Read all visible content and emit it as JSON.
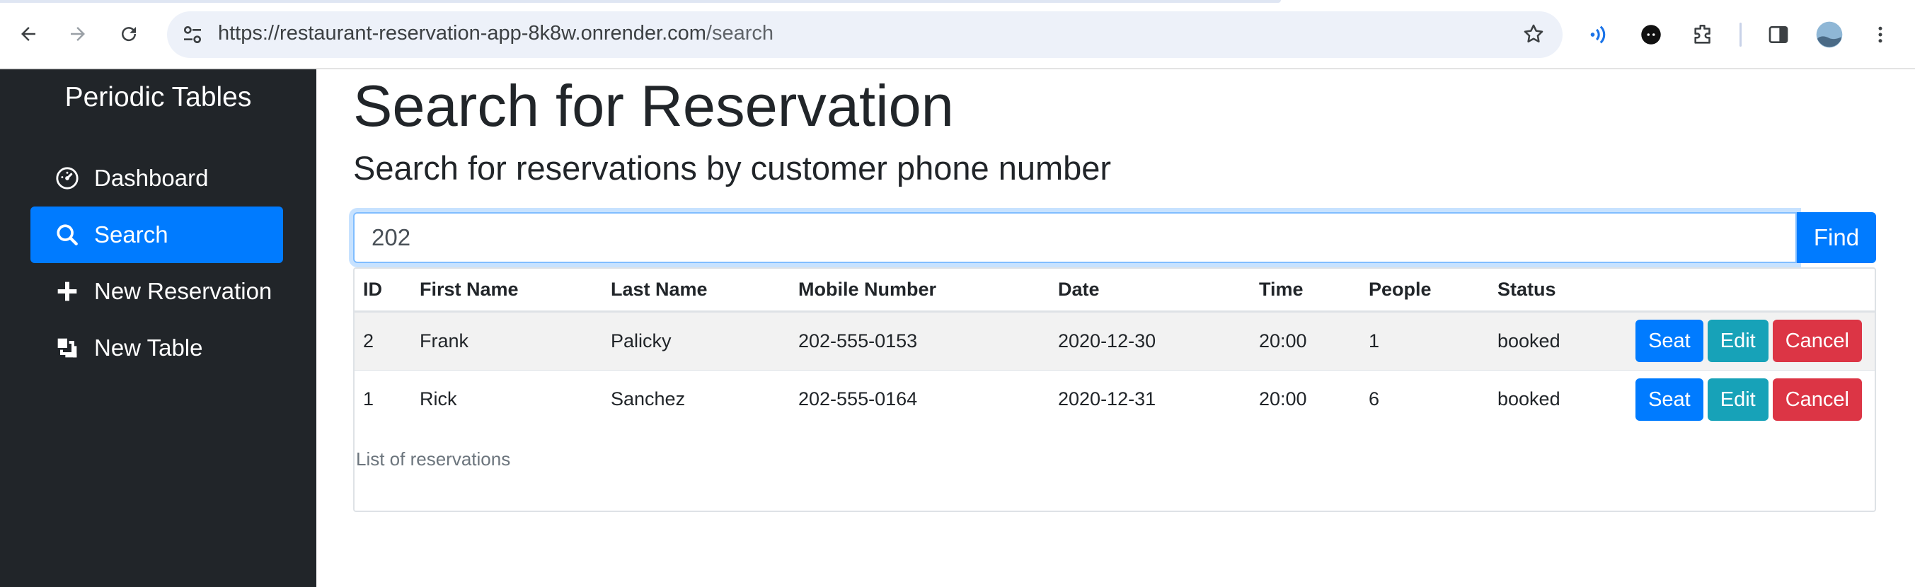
{
  "browser": {
    "url_host": "https://restaurant-reservation-app-8k8w.onrender.com",
    "url_path": "/search",
    "colors": {
      "omnibox_bg": "#edf1f9"
    }
  },
  "sidebar": {
    "brand": "Periodic Tables",
    "items": [
      {
        "label": "Dashboard",
        "icon": "dashboard-icon",
        "active": false
      },
      {
        "label": "Search",
        "icon": "search-icon",
        "active": true
      },
      {
        "label": "New Reservation",
        "icon": "plus-icon",
        "active": false
      },
      {
        "label": "New Table",
        "icon": "table-icon",
        "active": false
      }
    ]
  },
  "main": {
    "title": "Search for Reservation",
    "subtitle": "Search for reservations by customer phone number",
    "search": {
      "value": "202",
      "button_label": "Find"
    },
    "table": {
      "columns": [
        "ID",
        "First Name",
        "Last Name",
        "Mobile Number",
        "Date",
        "Time",
        "People",
        "Status"
      ],
      "rows": [
        {
          "id": "2",
          "first_name": "Frank",
          "last_name": "Palicky",
          "mobile": "202-555-0153",
          "date": "2020-12-30",
          "time": "20:00",
          "people": "1",
          "status": "booked"
        },
        {
          "id": "1",
          "first_name": "Rick",
          "last_name": "Sanchez",
          "mobile": "202-555-0164",
          "date": "2020-12-31",
          "time": "20:00",
          "people": "6",
          "status": "booked"
        }
      ],
      "actions": {
        "seat": "Seat",
        "edit": "Edit",
        "cancel": "Cancel"
      },
      "caption": "List of reservations"
    }
  },
  "colors": {
    "sidebar": "#212529",
    "primary": "#007bff",
    "info": "#17a2b8",
    "danger": "#dc3545"
  }
}
